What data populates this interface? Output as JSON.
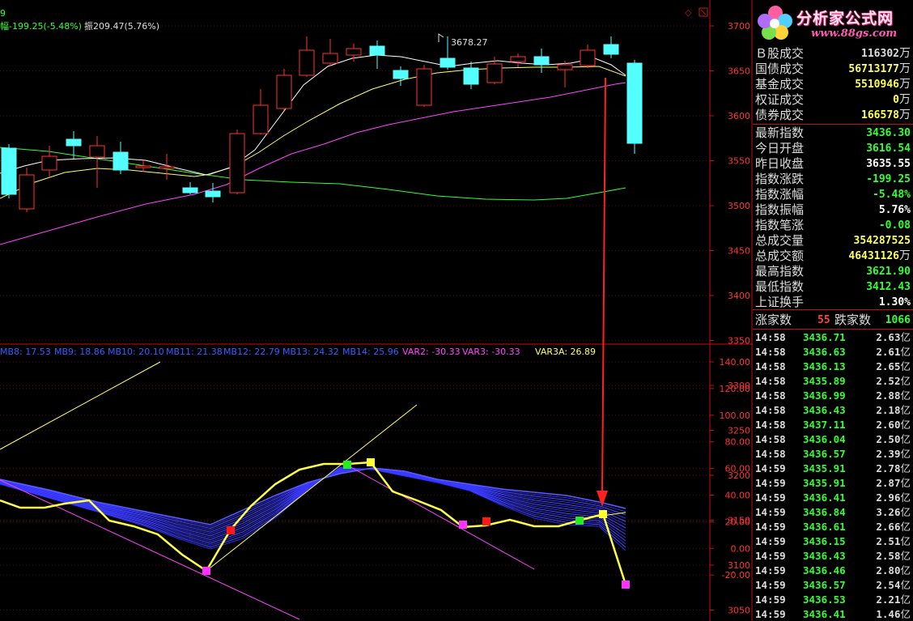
{
  "header": {
    "code_fragment": "9",
    "change_text": "幅-199.25(-5.48%)",
    "amplitude_text": "振209.47(5.76%)"
  },
  "price_chart": {
    "peak_label": "3678.27",
    "y_ticks": [
      "3700",
      "3650",
      "3600",
      "3550",
      "3500",
      "3450",
      "3400",
      "3350",
      "3300",
      "3250",
      "3200",
      "3150",
      "3100",
      "3050"
    ],
    "colors": {
      "up": "#ff3232",
      "down": "#54ffff",
      "ma_white": "#ffffff",
      "ma_yellow": "#ffff66",
      "ma_magenta": "#ff44ff",
      "ma_green": "#33ff33",
      "arrow": "#ff2020"
    }
  },
  "indicator": {
    "labels": [
      {
        "text": "MB8: 17.53",
        "color": "#3c5cff"
      },
      {
        "text": "MB9: 18.86",
        "color": "#3c5cff"
      },
      {
        "text": "MB10: 20.10",
        "color": "#3c5cff"
      },
      {
        "text": "MB11: 21.38",
        "color": "#3c5cff"
      },
      {
        "text": "MB12: 22.79",
        "color": "#3c5cff"
      },
      {
        "text": "MB13: 24.32",
        "color": "#3c5cff"
      },
      {
        "text": "MB14: 25.96",
        "color": "#3c5cff"
      },
      {
        "text": "VAR2: -30.33",
        "color": "#ff44ff"
      },
      {
        "text": "VAR3: -30.33",
        "color": "#ff44ff"
      },
      {
        "text": "VAR3A: 26.89",
        "color": "#ffff66"
      }
    ],
    "y_ticks": [
      "140.00",
      "120.00",
      "100.00",
      "80.00",
      "60.00",
      "40.00",
      "20.00",
      "0.00",
      "-20.00"
    ]
  },
  "logo": {
    "name": "分析家公式网",
    "url": "www.88gs.com"
  },
  "market_stats": [
    {
      "label": "Ｂ股成交",
      "value": "116302",
      "unit": "万",
      "color": "#dddddd"
    },
    {
      "label": "国债成交",
      "value": "56713177",
      "unit": "万",
      "color": "#ffff55"
    },
    {
      "label": "基金成交",
      "value": "5510946",
      "unit": "万",
      "color": "#ffff55"
    },
    {
      "label": "权证成交",
      "value": "0",
      "unit": "万",
      "color": "#ffff55"
    },
    {
      "label": "债券成交",
      "value": "166578",
      "unit": "万",
      "color": "#ffff55"
    }
  ],
  "index_stats": [
    {
      "label": "最新指数",
      "value": "3436.30",
      "color": "#33ff33"
    },
    {
      "label": "今日开盘",
      "value": "3616.54",
      "color": "#33ff33"
    },
    {
      "label": "昨日收盘",
      "value": "3635.55",
      "color": "#ffffff"
    },
    {
      "label": "指数涨跌",
      "value": "-199.25",
      "color": "#33ff33"
    },
    {
      "label": "指数涨幅",
      "value": "-5.48%",
      "color": "#33ff33"
    },
    {
      "label": "指数振幅",
      "value": "5.76%",
      "color": "#ffffff"
    },
    {
      "label": "指数笔涨",
      "value": "-0.08",
      "color": "#33ff33"
    },
    {
      "label": "总成交量",
      "value": "354287525",
      "color": "#ffff55"
    },
    {
      "label": "总成交额",
      "value": "46431126",
      "unit": "万",
      "color": "#ffff55"
    },
    {
      "label": "最高指数",
      "value": "3621.90",
      "color": "#33ff33"
    },
    {
      "label": "最低指数",
      "value": "3412.43",
      "color": "#33ff33"
    },
    {
      "label": "上证换手",
      "value": "1.30%",
      "color": "#ffffff"
    }
  ],
  "breadth": {
    "up_label": "涨家数",
    "up_value": "55",
    "down_label": "跌家数",
    "down_value": "1066"
  },
  "ticks": [
    {
      "time": "14:58",
      "price": "3436.71",
      "vol": "2.63",
      "unit": "亿"
    },
    {
      "time": "14:58",
      "price": "3436.63",
      "vol": "2.61",
      "unit": "亿"
    },
    {
      "time": "14:58",
      "price": "3436.13",
      "vol": "2.65",
      "unit": "亿"
    },
    {
      "time": "14:58",
      "price": "3435.89",
      "vol": "2.52",
      "unit": "亿"
    },
    {
      "time": "14:58",
      "price": "3436.99",
      "vol": "2.88",
      "unit": "亿"
    },
    {
      "time": "14:58",
      "price": "3436.43",
      "vol": "2.18",
      "unit": "亿"
    },
    {
      "time": "14:58",
      "price": "3437.11",
      "vol": "2.60",
      "unit": "亿"
    },
    {
      "time": "14:58",
      "price": "3436.04",
      "vol": "2.50",
      "unit": "亿"
    },
    {
      "time": "14:58",
      "price": "3436.57",
      "vol": "2.39",
      "unit": "亿"
    },
    {
      "time": "14:59",
      "price": "3435.91",
      "vol": "2.78",
      "unit": "亿"
    },
    {
      "time": "14:59",
      "price": "3435.91",
      "vol": "2.87",
      "unit": "亿"
    },
    {
      "time": "14:59",
      "price": "3436.41",
      "vol": "2.96",
      "unit": "亿"
    },
    {
      "time": "14:59",
      "price": "3436.84",
      "vol": "3.26",
      "unit": "亿"
    },
    {
      "time": "14:59",
      "price": "3436.61",
      "vol": "2.66",
      "unit": "亿"
    },
    {
      "time": "14:59",
      "price": "3436.15",
      "vol": "2.51",
      "unit": "亿"
    },
    {
      "time": "14:59",
      "price": "3436.43",
      "vol": "2.58",
      "unit": "亿"
    },
    {
      "time": "14:59",
      "price": "3436.46",
      "vol": "2.80",
      "unit": "亿"
    },
    {
      "time": "14:59",
      "price": "3436.57",
      "vol": "2.54",
      "unit": "亿"
    },
    {
      "time": "14:59",
      "price": "3436.53",
      "vol": "2.21",
      "unit": "亿"
    },
    {
      "time": "14:59",
      "price": "3436.41",
      "vol": "1.46",
      "unit": "亿"
    }
  ]
}
